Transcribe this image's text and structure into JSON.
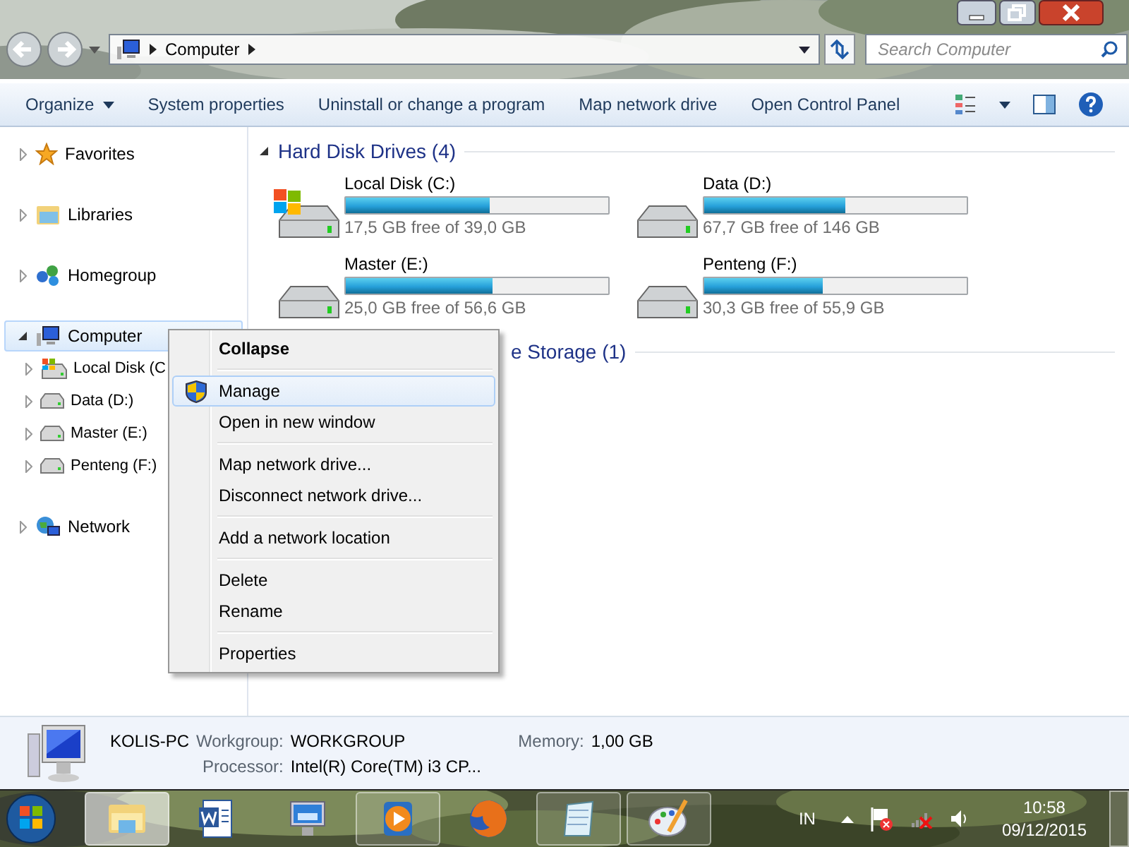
{
  "address_bar": {
    "path": [
      "Computer"
    ]
  },
  "search": {
    "placeholder": "Search Computer"
  },
  "toolbar": [
    {
      "label": "Organize",
      "dropdown": true
    },
    {
      "label": "System properties",
      "dropdown": false
    },
    {
      "label": "Uninstall or change a program",
      "dropdown": false
    },
    {
      "label": "Map network drive",
      "dropdown": false
    },
    {
      "label": "Open Control Panel",
      "dropdown": false
    }
  ],
  "navigation": [
    {
      "label": "Favorites",
      "kind": "favorites",
      "expanded": false,
      "selected": false
    },
    {
      "label": "Libraries",
      "kind": "libraries",
      "expanded": false,
      "selected": false
    },
    {
      "label": "Homegroup",
      "kind": "homegroup",
      "expanded": false,
      "selected": false
    },
    {
      "label": "Computer",
      "kind": "computer",
      "expanded": true,
      "selected": true,
      "children": [
        {
          "label": "Local Disk (C",
          "kind": "system",
          "expanded": false,
          "selected": false
        },
        {
          "label": "Data (D:)",
          "kind": "drive",
          "expanded": false,
          "selected": false
        },
        {
          "label": "Master (E:)",
          "kind": "drive",
          "expanded": false,
          "selected": false
        },
        {
          "label": "Penteng (F:)",
          "kind": "drive",
          "expanded": false,
          "selected": false
        }
      ]
    },
    {
      "label": "Network",
      "kind": "network",
      "expanded": false,
      "selected": false
    }
  ],
  "sections": [
    {
      "title": "Hard Disk Drives (4)",
      "kind": "full",
      "drives": [
        {
          "name": "Local Disk (C:)",
          "kind": "system",
          "level": 0.55,
          "free": "17,5 GB free of 39,0 GB"
        },
        {
          "name": "Data (D:)",
          "kind": "drive",
          "level": 0.54,
          "free": "67,7 GB free of 146 GB"
        },
        {
          "name": "Master (E:)",
          "kind": "drive",
          "level": 0.56,
          "free": "25,0 GB free of 56,6 GB"
        },
        {
          "name": "Penteng (F:)",
          "kind": "drive",
          "level": 0.45,
          "free": "30,3 GB free of 55,9 GB"
        }
      ]
    },
    {
      "title": "e Storage (1)",
      "kind": "covered"
    }
  ],
  "context_menu": {
    "items": [
      {
        "kind": "item",
        "label": "Collapse",
        "default": true,
        "selected": false,
        "shield": false
      },
      {
        "kind": "separator"
      },
      {
        "kind": "item",
        "label": "Manage",
        "default": false,
        "selected": true,
        "shield": true
      },
      {
        "kind": "item",
        "label": "Open in new window",
        "default": false,
        "selected": false,
        "shield": false
      },
      {
        "kind": "separator"
      },
      {
        "kind": "item",
        "label": "Map network drive...",
        "default": false,
        "selected": false,
        "shield": false
      },
      {
        "kind": "item",
        "label": "Disconnect network drive...",
        "default": false,
        "selected": false,
        "shield": false
      },
      {
        "kind": "separator"
      },
      {
        "kind": "item",
        "label": "Add a network location",
        "default": false,
        "selected": false,
        "shield": false
      },
      {
        "kind": "separator"
      },
      {
        "kind": "item",
        "label": "Delete",
        "default": false,
        "selected": false,
        "shield": false
      },
      {
        "kind": "item",
        "label": "Rename",
        "default": false,
        "selected": false,
        "shield": false
      },
      {
        "kind": "separator"
      },
      {
        "kind": "item",
        "label": "Properties",
        "default": false,
        "selected": false,
        "shield": false
      }
    ]
  },
  "details": {
    "name": "KOLIS-PC",
    "fields": [
      {
        "label": "Workgroup:",
        "value": "WORKGROUP"
      },
      {
        "label": "Memory:",
        "value": "1,00 GB"
      },
      {
        "label": "Processor:",
        "value": "Intel(R) Core(TM) i3 CP..."
      }
    ]
  },
  "taskbar": {
    "apps": [
      {
        "kind": "explorer",
        "running": true,
        "selected": true
      },
      {
        "kind": "word",
        "running": false,
        "selected": false
      },
      {
        "kind": "remote",
        "running": false,
        "selected": false
      },
      {
        "kind": "media",
        "running": true,
        "selected": false
      },
      {
        "kind": "firefox",
        "running": false,
        "selected": false
      },
      {
        "kind": "notepad",
        "running": true,
        "selected": false
      },
      {
        "kind": "paint",
        "running": true,
        "selected": false
      }
    ],
    "language": "IN",
    "time": "10:58",
    "date": "09/12/2015"
  }
}
